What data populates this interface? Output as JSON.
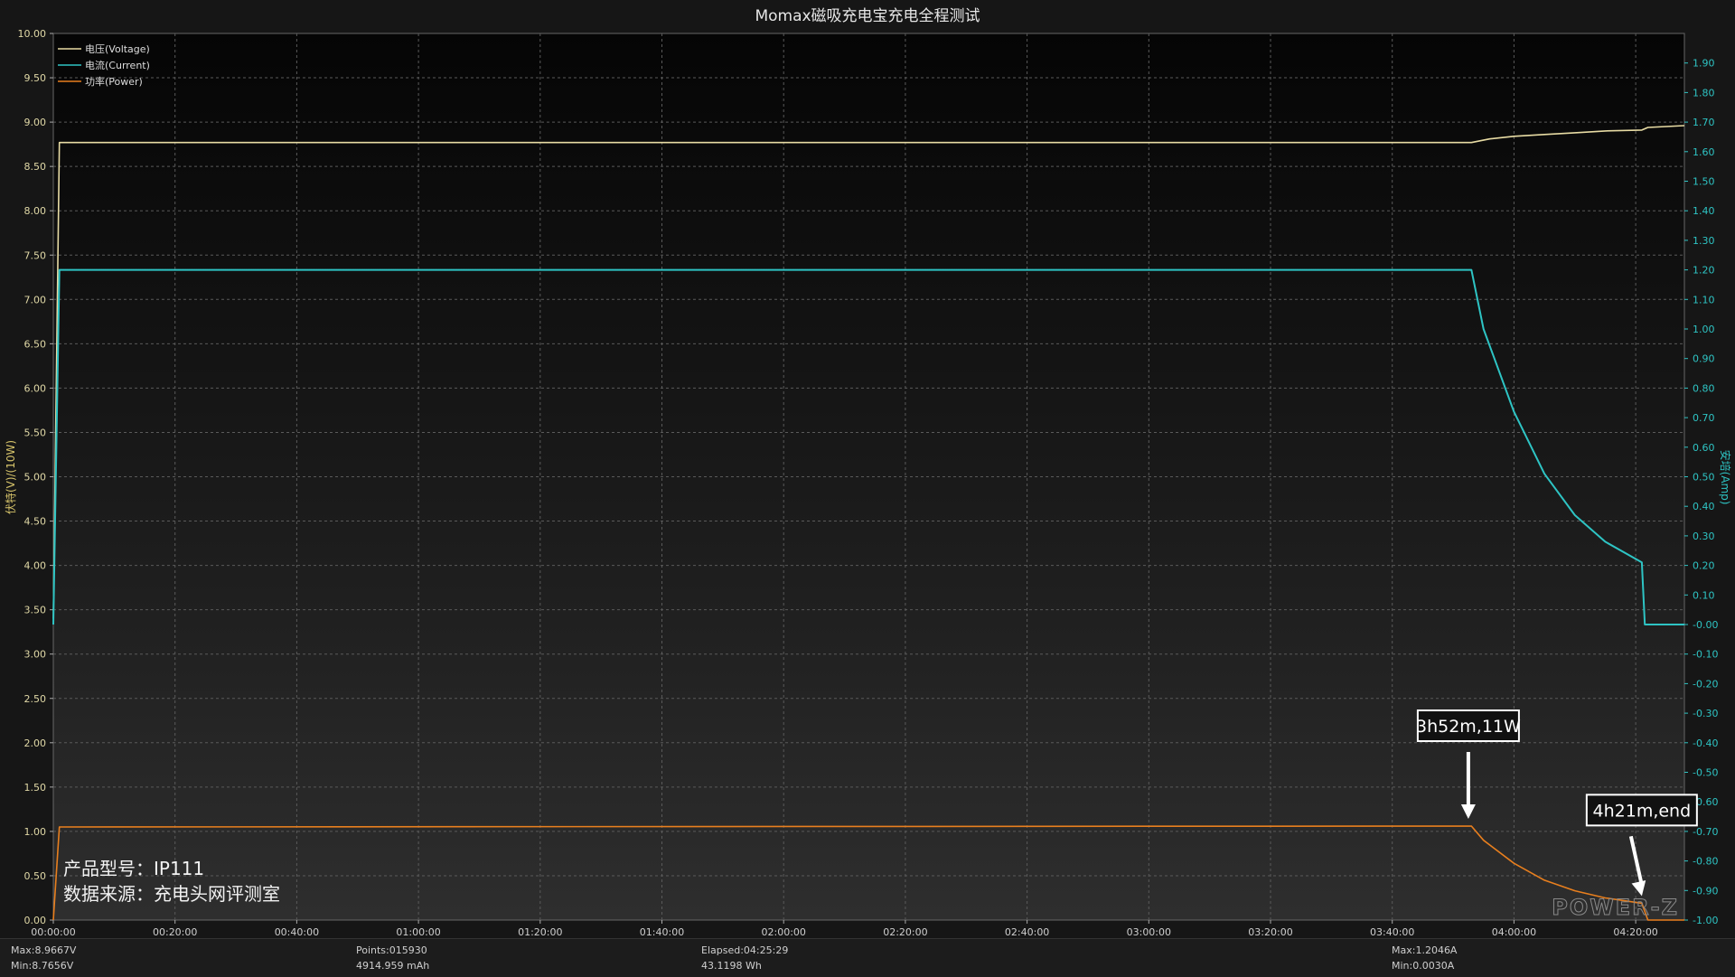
{
  "chart_data": {
    "type": "line",
    "title": "Momax磁吸充电宝充电全程测试",
    "ylabel_left": "伏特(V)/(10W)",
    "ylabel_right": "安培(Amp)",
    "ylim_left": [
      0,
      10
    ],
    "ylim_right": [
      -1,
      2
    ],
    "y_ticks_left": [
      "0.00",
      "0.50",
      "1.00",
      "1.50",
      "2.00",
      "2.50",
      "3.00",
      "3.50",
      "4.00",
      "4.50",
      "5.00",
      "5.50",
      "6.00",
      "6.50",
      "7.00",
      "7.50",
      "8.00",
      "8.50",
      "9.00",
      "9.50",
      "10.00"
    ],
    "y_ticks_right": [
      "-1.00",
      "-0.90",
      "-0.80",
      "-0.70",
      "-0.60",
      "-0.50",
      "-0.40",
      "-0.30",
      "-0.20",
      "-0.10",
      "-0.00",
      "0.10",
      "0.20",
      "0.30",
      "0.40",
      "0.50",
      "0.60",
      "0.70",
      "0.80",
      "0.90",
      "1.00",
      "1.10",
      "1.20",
      "1.30",
      "1.40",
      "1.50",
      "1.60",
      "1.70",
      "1.80",
      "1.90"
    ],
    "x_ticks": [
      "00:00:00",
      "00:20:00",
      "00:40:00",
      "01:00:00",
      "01:20:00",
      "01:40:00",
      "02:00:00",
      "02:20:00",
      "02:40:00",
      "03:00:00",
      "03:20:00",
      "03:40:00",
      "04:00:00",
      "04:20:00"
    ],
    "x_unit": "minutes",
    "xlim": [
      0,
      268
    ],
    "grid": true,
    "legend_position": "top-left",
    "series": [
      {
        "name": "电压(Voltage)",
        "axis": "left",
        "color": "#e8dca4",
        "x": [
          0,
          1,
          233,
          236,
          240,
          245,
          250,
          255,
          261,
          262,
          268
        ],
        "y": [
          3.4,
          8.77,
          8.77,
          8.81,
          8.84,
          8.86,
          8.88,
          8.9,
          8.91,
          8.94,
          8.96
        ]
      },
      {
        "name": "电流(Current)",
        "axis": "right",
        "color": "#2ec4c4",
        "x": [
          0,
          1,
          233,
          235,
          240,
          245,
          250,
          255,
          261,
          261.5,
          268
        ],
        "y": [
          0.0,
          1.2,
          1.2,
          1.0,
          0.72,
          0.51,
          0.37,
          0.28,
          0.21,
          0.0,
          0.0
        ]
      },
      {
        "name": "功率(Power)",
        "axis": "left",
        "color": "#e87f1e",
        "x": [
          0,
          1,
          233,
          235,
          240,
          245,
          250,
          255,
          261,
          262,
          268
        ],
        "y": [
          0.0,
          1.05,
          1.06,
          0.9,
          0.64,
          0.45,
          0.33,
          0.25,
          0.19,
          0.0,
          0.0
        ]
      }
    ],
    "annotations": [
      {
        "text": "3h52m,11W",
        "x": 232.5,
        "y": 1.06
      },
      {
        "text": "4h21m,end",
        "x": 261,
        "y": 0.19
      }
    ],
    "notes": [
      "产品型号：IP111",
      "数据来源：充电头网评测室"
    ],
    "watermark": "POWER-Z"
  },
  "footer": {
    "max_v": "Max:8.9667V",
    "min_v": "Min:8.7656V",
    "points": "Points:015930",
    "mah": "4914.959 mAh",
    "elapsed": "Elapsed:04:25:29",
    "wh": "43.1198 Wh",
    "max_a": "Max:1.2046A",
    "min_a": "Min:0.0030A"
  }
}
